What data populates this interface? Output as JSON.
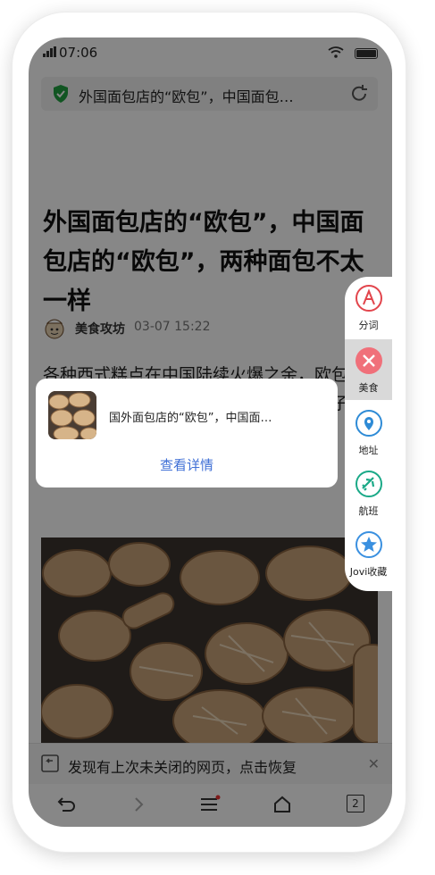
{
  "status_bar": {
    "time": "07:06"
  },
  "browser": {
    "url_title": "外国面包店的“欧包”，中国面包…"
  },
  "article": {
    "title": "外国面包店的“欧包”，中国面包店的“欧包”，两种面包不太一样",
    "author": "美食攻坊",
    "date": "03-07 15:22",
    "body": "各种西式糕点在中国陆续火爆之余，欧包也开始在中国出现，吸引了大批顾客。一下子，欧包成了“网红美食”。"
  },
  "restore_bar": {
    "text": "发现有上次未关闭的网页，点击恢复"
  },
  "bottom_nav": {
    "tab_count": "2"
  },
  "popup_card": {
    "text": "国外面包店的“欧包”，中国面…",
    "link": "查看详情"
  },
  "side_panel": {
    "items": [
      {
        "label": "分词",
        "icon": "letter-a-icon",
        "color": "#e2454c"
      },
      {
        "label": "美食",
        "icon": "utensils-icon",
        "color": "#f0707a"
      },
      {
        "label": "地址",
        "icon": "location-pin-icon",
        "color": "#2e8bd6"
      },
      {
        "label": "航班",
        "icon": "airplane-icon",
        "color": "#1aa987"
      },
      {
        "label": "Jovi收藏",
        "icon": "star-icon",
        "color": "#3a90e0"
      }
    ]
  },
  "colors": {
    "accent_blue": "#3f6fd6",
    "shield_green": "#20a040"
  }
}
